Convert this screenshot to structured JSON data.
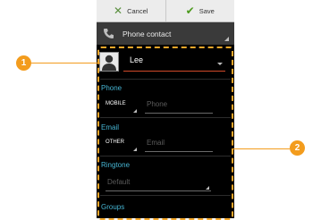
{
  "toolbar": {
    "cancel_label": "Cancel",
    "save_label": "Save",
    "cancel_icon": "x-icon",
    "save_icon": "checkmark-icon"
  },
  "account": {
    "label": "Phone contact",
    "icon": "phone-icon"
  },
  "name": {
    "value": "Lee"
  },
  "phone": {
    "section_title": "Phone",
    "type": "MOBILE",
    "placeholder": "Phone"
  },
  "email": {
    "section_title": "Email",
    "type": "OTHER",
    "placeholder": "Email"
  },
  "ringtone": {
    "section_title": "Ringtone",
    "value": "Default"
  },
  "groups": {
    "section_title": "Groups"
  },
  "callouts": {
    "one": "1",
    "two": "2"
  },
  "colors": {
    "accent": "#46b4d2",
    "callout": "#f39c1d",
    "name_underline": "#d14a2a"
  }
}
